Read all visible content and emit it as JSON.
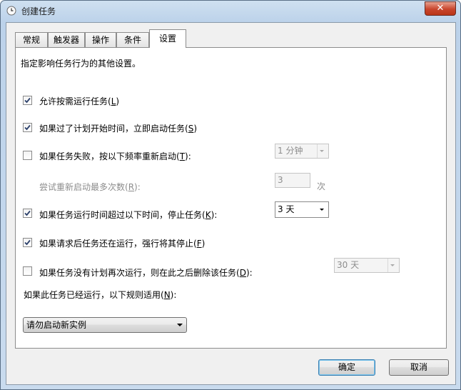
{
  "window": {
    "title": "创建任务",
    "close_glyph": "✕"
  },
  "tabs": [
    {
      "label": "常规"
    },
    {
      "label": "触发器"
    },
    {
      "label": "操作"
    },
    {
      "label": "条件"
    },
    {
      "label": "设置",
      "active": true
    }
  ],
  "settings": {
    "intro": "指定影响任务行为的其他设置。",
    "allow_on_demand": {
      "label": "允许按需运行任务(",
      "key": "L",
      "suffix": ")",
      "checked": true
    },
    "run_after_missed": {
      "label": "如果过了计划开始时间，立即启动任务(",
      "key": "S",
      "suffix": ")",
      "checked": true
    },
    "restart_on_fail": {
      "label": "如果任务失败，按以下频率重新启动(",
      "key": "T",
      "suffix": "):",
      "checked": false,
      "interval": "1 分钟"
    },
    "restart_attempts": {
      "label": "尝试重新启动最多次数(",
      "key": "R",
      "suffix": "):",
      "value": "3",
      "unit": "次"
    },
    "stop_if_longer": {
      "label": "如果任务运行时间超过以下时间，停止任务(",
      "key": "K",
      "suffix": "):",
      "checked": true,
      "duration": "3 天"
    },
    "force_stop": {
      "label": "如果请求后任务还在运行，强行将其停止(",
      "key": "F",
      "suffix": ")",
      "checked": true
    },
    "delete_if_not_scheduled": {
      "label": "如果任务没有计划再次运行，则在此之后删除该任务(",
      "key": "D",
      "suffix": "):",
      "checked": false,
      "after": "30 天"
    },
    "if_running_rule": {
      "label": "如果此任务已经运行，以下规则适用(",
      "key": "N",
      "suffix": "):",
      "value": "请勿启动新实例"
    }
  },
  "buttons": {
    "ok": "确定",
    "cancel": "取消"
  },
  "colors": {
    "title_bar": "#bcd2ea",
    "close_button": "#c8452c",
    "panel": "#ffffff",
    "disabled_text": "#8d8d8d"
  }
}
